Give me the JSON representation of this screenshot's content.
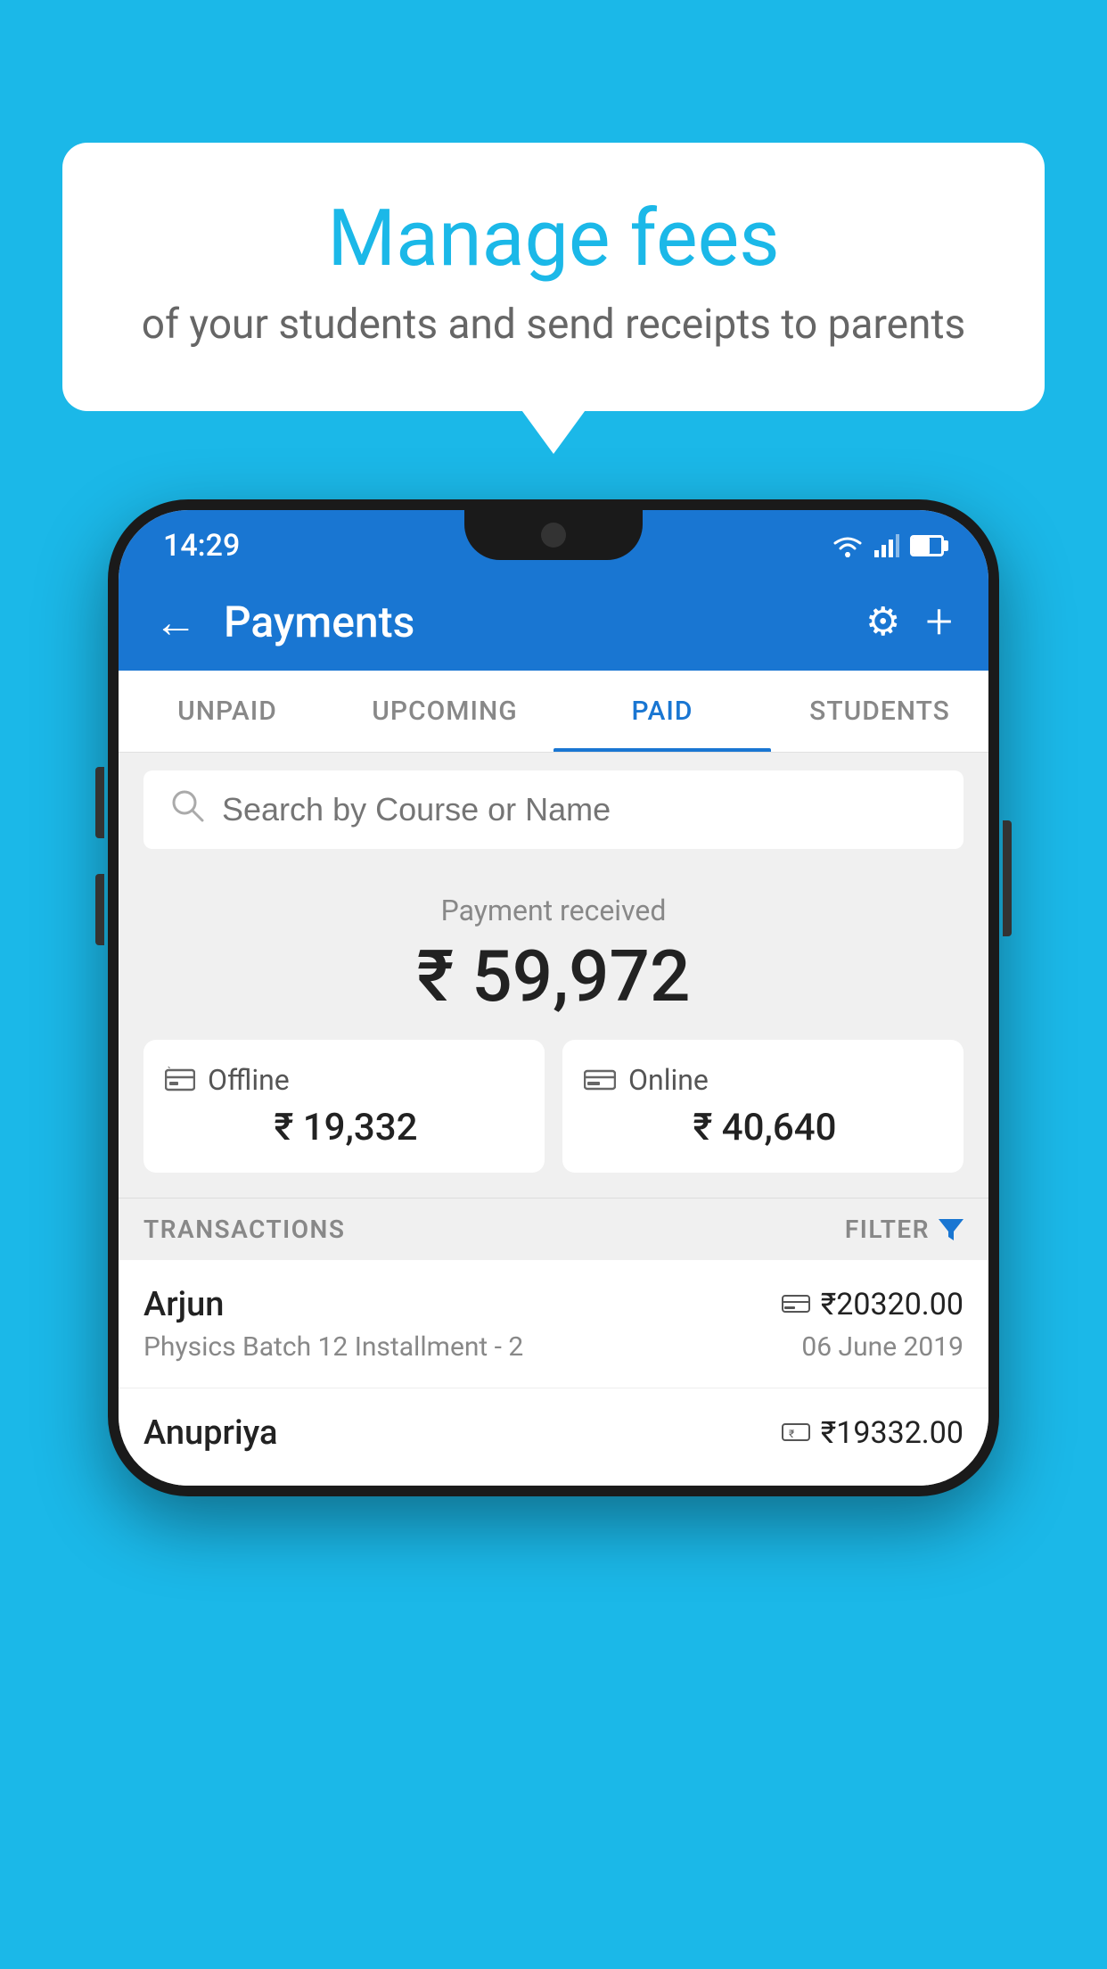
{
  "background_color": "#1BB8E8",
  "bubble": {
    "title": "Manage fees",
    "subtitle": "of your students and send receipts to parents"
  },
  "status_bar": {
    "time": "14:29",
    "wifi_icon": "wifi",
    "signal_icon": "signal",
    "battery_icon": "battery"
  },
  "app_bar": {
    "title": "Payments",
    "back_label": "←",
    "gear_label": "⚙",
    "plus_label": "+"
  },
  "tabs": [
    {
      "label": "UNPAID",
      "active": false
    },
    {
      "label": "UPCOMING",
      "active": false
    },
    {
      "label": "PAID",
      "active": true
    },
    {
      "label": "STUDENTS",
      "active": false
    }
  ],
  "search": {
    "placeholder": "Search by Course or Name"
  },
  "payment_summary": {
    "label": "Payment received",
    "amount": "₹ 59,972",
    "offline": {
      "label": "Offline",
      "amount": "₹ 19,332"
    },
    "online": {
      "label": "Online",
      "amount": "₹ 40,640"
    }
  },
  "transactions_section": {
    "label": "TRANSACTIONS",
    "filter_label": "FILTER"
  },
  "transactions": [
    {
      "name": "Arjun",
      "detail": "Physics Batch 12 Installment - 2",
      "amount": "₹20320.00",
      "date": "06 June 2019",
      "payment_type": "online"
    },
    {
      "name": "Anupriya",
      "detail": "",
      "amount": "₹19332.00",
      "date": "",
      "payment_type": "offline"
    }
  ]
}
